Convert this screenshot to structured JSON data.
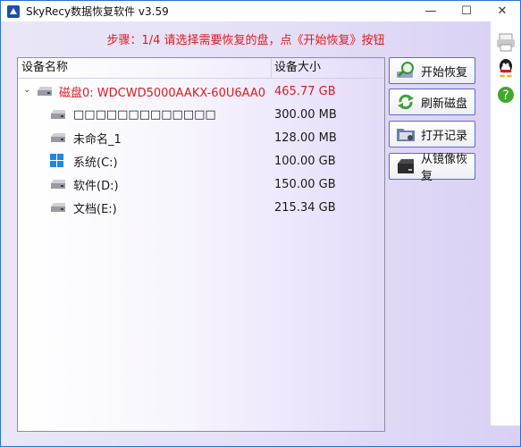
{
  "window": {
    "title": "SkyRecy数据恢复软件 v3.59",
    "controls": {
      "minimize": "—",
      "maximize": "☐",
      "close": "✕"
    }
  },
  "prompt": "步骤：1/4 请选择需要恢复的盘，点《开始恢复》按钮",
  "table": {
    "columns": {
      "name": "设备名称",
      "size": "设备大小"
    },
    "rows": [
      {
        "name": "磁盘0: WDCWD5000AAKX-60U6AA0",
        "size": "465.77 GB",
        "kind": "disk",
        "expanded": true,
        "icon": "hdd-icon"
      },
      {
        "name": "□□□□□□□□□□□□□",
        "size": "300.00 MB",
        "kind": "partition",
        "icon": "hdd-icon"
      },
      {
        "name": "未命名_1",
        "size": "128.00 MB",
        "kind": "partition",
        "icon": "hdd-icon"
      },
      {
        "name": "系统(C:)",
        "size": "100.00 GB",
        "kind": "partition",
        "icon": "windows-icon"
      },
      {
        "name": "软件(D:)",
        "size": "150.00 GB",
        "kind": "partition",
        "icon": "hdd-icon"
      },
      {
        "name": "文档(E:)",
        "size": "215.34 GB",
        "kind": "partition",
        "icon": "hdd-icon"
      }
    ]
  },
  "buttons": {
    "start": "开始恢复",
    "refresh": "刷新磁盘",
    "open_record": "打开记录",
    "from_image": "从镜像恢复"
  },
  "side_icons": [
    "print-icon",
    "qq-icon",
    "help-icon"
  ],
  "colors": {
    "accent_red": "#e1191e",
    "button_border": "#5b6bc9"
  }
}
